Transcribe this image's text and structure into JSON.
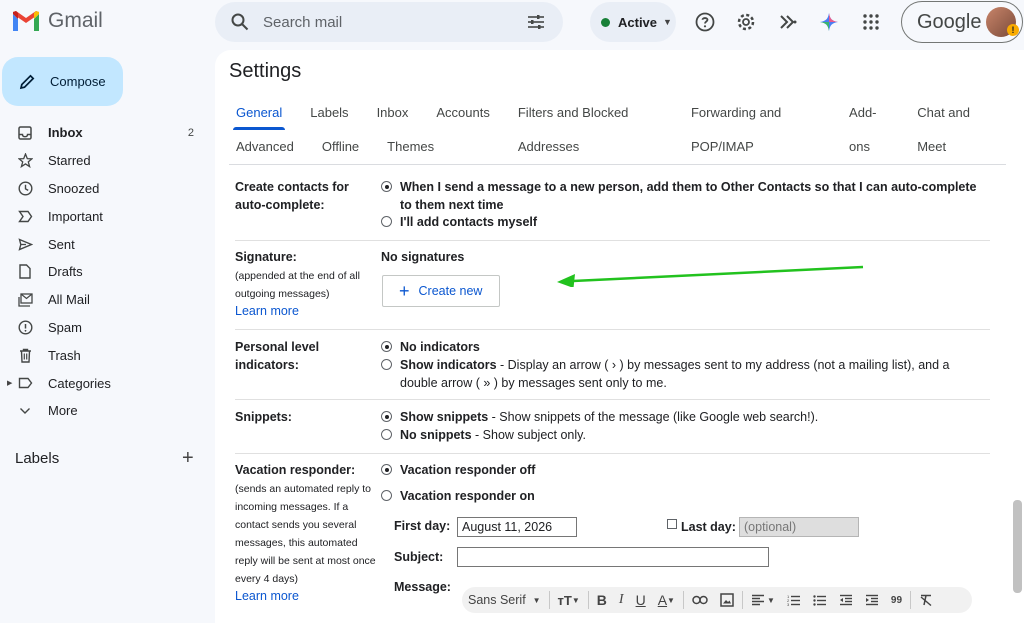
{
  "app": {
    "name": "Gmail"
  },
  "search": {
    "placeholder": "Search mail"
  },
  "status": {
    "label": "Active",
    "color": "#188038"
  },
  "account": {
    "brand": "Google",
    "badge": "!"
  },
  "compose": {
    "label": "Compose"
  },
  "sidebar": {
    "items": [
      {
        "label": "Inbox",
        "count": "2",
        "icon": "inbox-icon"
      },
      {
        "label": "Starred",
        "count": "",
        "icon": "star-icon"
      },
      {
        "label": "Snoozed",
        "count": "",
        "icon": "clock-icon"
      },
      {
        "label": "Important",
        "count": "",
        "icon": "label-important-icon"
      },
      {
        "label": "Sent",
        "count": "",
        "icon": "send-icon"
      },
      {
        "label": "Drafts",
        "count": "",
        "icon": "draft-icon"
      },
      {
        "label": "All Mail",
        "count": "",
        "icon": "all-mail-icon"
      },
      {
        "label": "Spam",
        "count": "",
        "icon": "spam-icon"
      },
      {
        "label": "Trash",
        "count": "",
        "icon": "trash-icon"
      },
      {
        "label": "Categories",
        "count": "",
        "icon": "label-icon"
      },
      {
        "label": "More",
        "count": "",
        "icon": "chevron-down-icon"
      }
    ],
    "labels_heading": "Labels"
  },
  "settings": {
    "title": "Settings",
    "tabs_row1": [
      "General",
      "Labels",
      "Inbox",
      "Accounts",
      "Filters and Blocked Addresses",
      "Forwarding and POP/IMAP",
      "Add-ons",
      "Chat and Meet"
    ],
    "tabs_row2": [
      "Advanced",
      "Offline",
      "Themes"
    ],
    "selected_tab": "General",
    "contacts": {
      "label": "Create contacts for auto-complete:",
      "opt1": "When I send a message to a new person, add them to Other Contacts so that I can auto-complete to them next time",
      "opt2": "I'll add contacts myself"
    },
    "signature": {
      "label": "Signature:",
      "sub": "(appended at the end of all outgoing messages)",
      "learn_more": "Learn more",
      "none": "No signatures",
      "create_new": "Create new",
      "annotation_color": "#22c21e"
    },
    "indicators": {
      "label": "Personal level indicators:",
      "opt1": "No indicators",
      "opt2_bold": "Show indicators",
      "opt2_rest": " - Display an arrow ( › ) by messages sent to my address (not a mailing list), and a double arrow ( » ) by messages sent only to me."
    },
    "snippets": {
      "label": "Snippets:",
      "opt1_bold": "Show snippets",
      "opt1_rest": " - Show snippets of the message (like Google web search!).",
      "opt2_bold": "No snippets",
      "opt2_rest": " - Show subject only."
    },
    "vacation": {
      "label": "Vacation responder:",
      "sub": "(sends an automated reply to incoming messages. If a contact sends you several messages, this automated reply will be sent at most once every 4 days)",
      "learn_more": "Learn more",
      "off": "Vacation responder off",
      "on": "Vacation responder on",
      "first_day_label": "First day:",
      "first_day_value": "August 11, 2026",
      "last_day_label": "Last day:",
      "last_day_placeholder": "(optional)",
      "subject_label": "Subject:",
      "subject_value": "",
      "message_label": "Message:",
      "font": "Sans Serif",
      "quote_glyph": "99"
    }
  }
}
